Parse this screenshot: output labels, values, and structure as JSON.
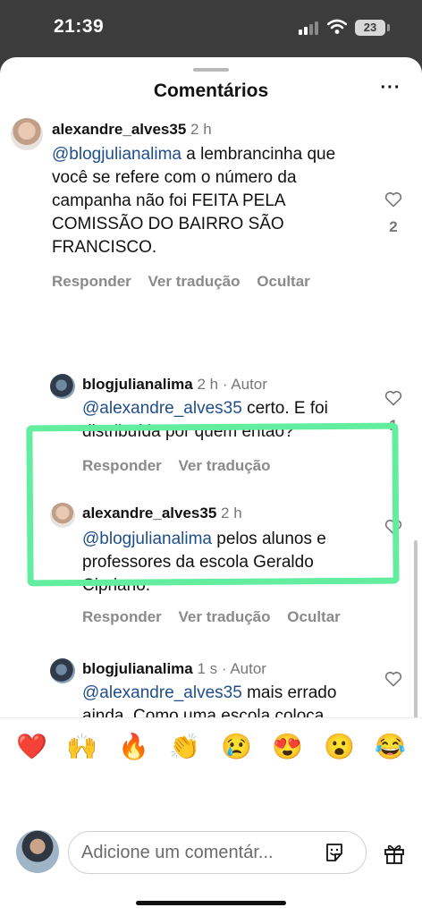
{
  "status_bar": {
    "time": "21:39",
    "battery": "23"
  },
  "header": {
    "title": "Comentários",
    "more": "···"
  },
  "comments": [
    {
      "username": "alexandre_alves35",
      "time": "2 h",
      "mention": "@blogjulianalima",
      "text": " a lembrancinha que você  se refere com o número da campanha não foi  FEITA PELA COMISSÃO DO BAIRRO SÃO FRANCISCO.",
      "actions": [
        "Responder",
        "Ver tradução",
        "Ocultar"
      ],
      "likes": "2"
    },
    {
      "username": "blogjulianalima",
      "time": "2 h · Autor",
      "mention": "@alexandre_alves35",
      "text": " certo. E foi distribuída por quem então?",
      "actions": [
        "Responder",
        "Ver tradução"
      ],
      "likes": "1"
    },
    {
      "username": "alexandre_alves35",
      "time": "2 h",
      "mention": "@blogjulianalima",
      "text": " pelos alunos e professores da escola Geraldo Cipriano.",
      "actions": [
        "Responder",
        "Ver tradução",
        "Ocultar"
      ],
      "likes": ""
    },
    {
      "username": "blogjulianalima",
      "time": "1 s · Autor",
      "mention": "@alexandre_alves35",
      "text": " mais errado ainda. Como uma escola coloca crianças para fazer politicagem???? A imagem do prefeito com o número do partido? Isso é lembrancinha pra criança fazer?",
      "actions": [],
      "likes": ""
    }
  ],
  "reactions": [
    "❤️",
    "🙌",
    "🔥",
    "👏",
    "😢",
    "😍",
    "😮",
    "😂"
  ],
  "composer": {
    "placeholder": "Adicione um comentár..."
  },
  "colors": {
    "mention": "#1f4e8c",
    "highlight": "#63ed9f"
  },
  "icons": [
    "heart-icon",
    "sticker-icon",
    "gift-icon",
    "wifi-icon",
    "signal-icon"
  ]
}
